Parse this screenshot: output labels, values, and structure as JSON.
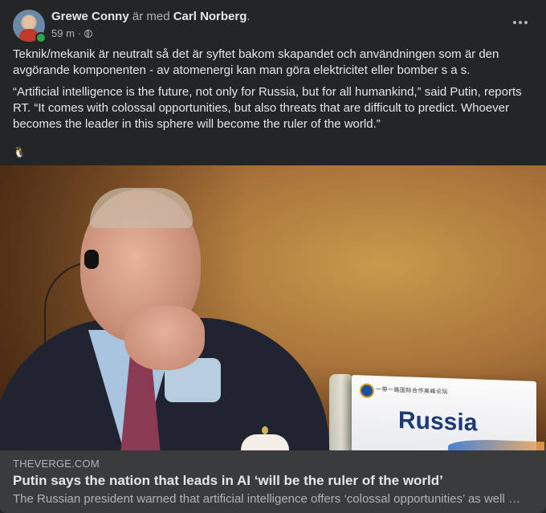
{
  "post": {
    "author": "Grewe Conny",
    "with_text": "är med",
    "tagged": "Carl Norberg",
    "tagged_suffix": ".",
    "time": "59 m",
    "separator": "·",
    "audience_icon": "globe-icon",
    "paragraphs": [
      "Teknik/mekanik är neutralt så det är syftet bakom skapandet och användningen som är den avgörande komponenten - av atomenergi kan man göra elektricitet eller bomber s a s.",
      "“Artificial intelligence is the future, not only for Russia, but for all humankind,” said Putin, reports RT. “It comes with colossal opportunities, but also threats that are difficult to predict. Whoever becomes the leader in this sphere will become the ruler of the world.”"
    ],
    "emoji": "🐧"
  },
  "link": {
    "domain": "THEVERGE.COM",
    "title": "Putin says the nation that leads in AI ‘will be the ruler of the world’",
    "description": "The Russian president warned that artificial intelligence offers ‘colossal opportunities’ as well as dangers",
    "image": {
      "nameplate_text": "Russia",
      "nameplate_small_text": "一带一路国际合作高峰论坛"
    }
  },
  "colors": {
    "background": "#242526",
    "link_panel": "#3a3b3c",
    "primary_text": "#e4e6eb",
    "secondary_text": "#b0b3b8",
    "online": "#31a24c"
  }
}
